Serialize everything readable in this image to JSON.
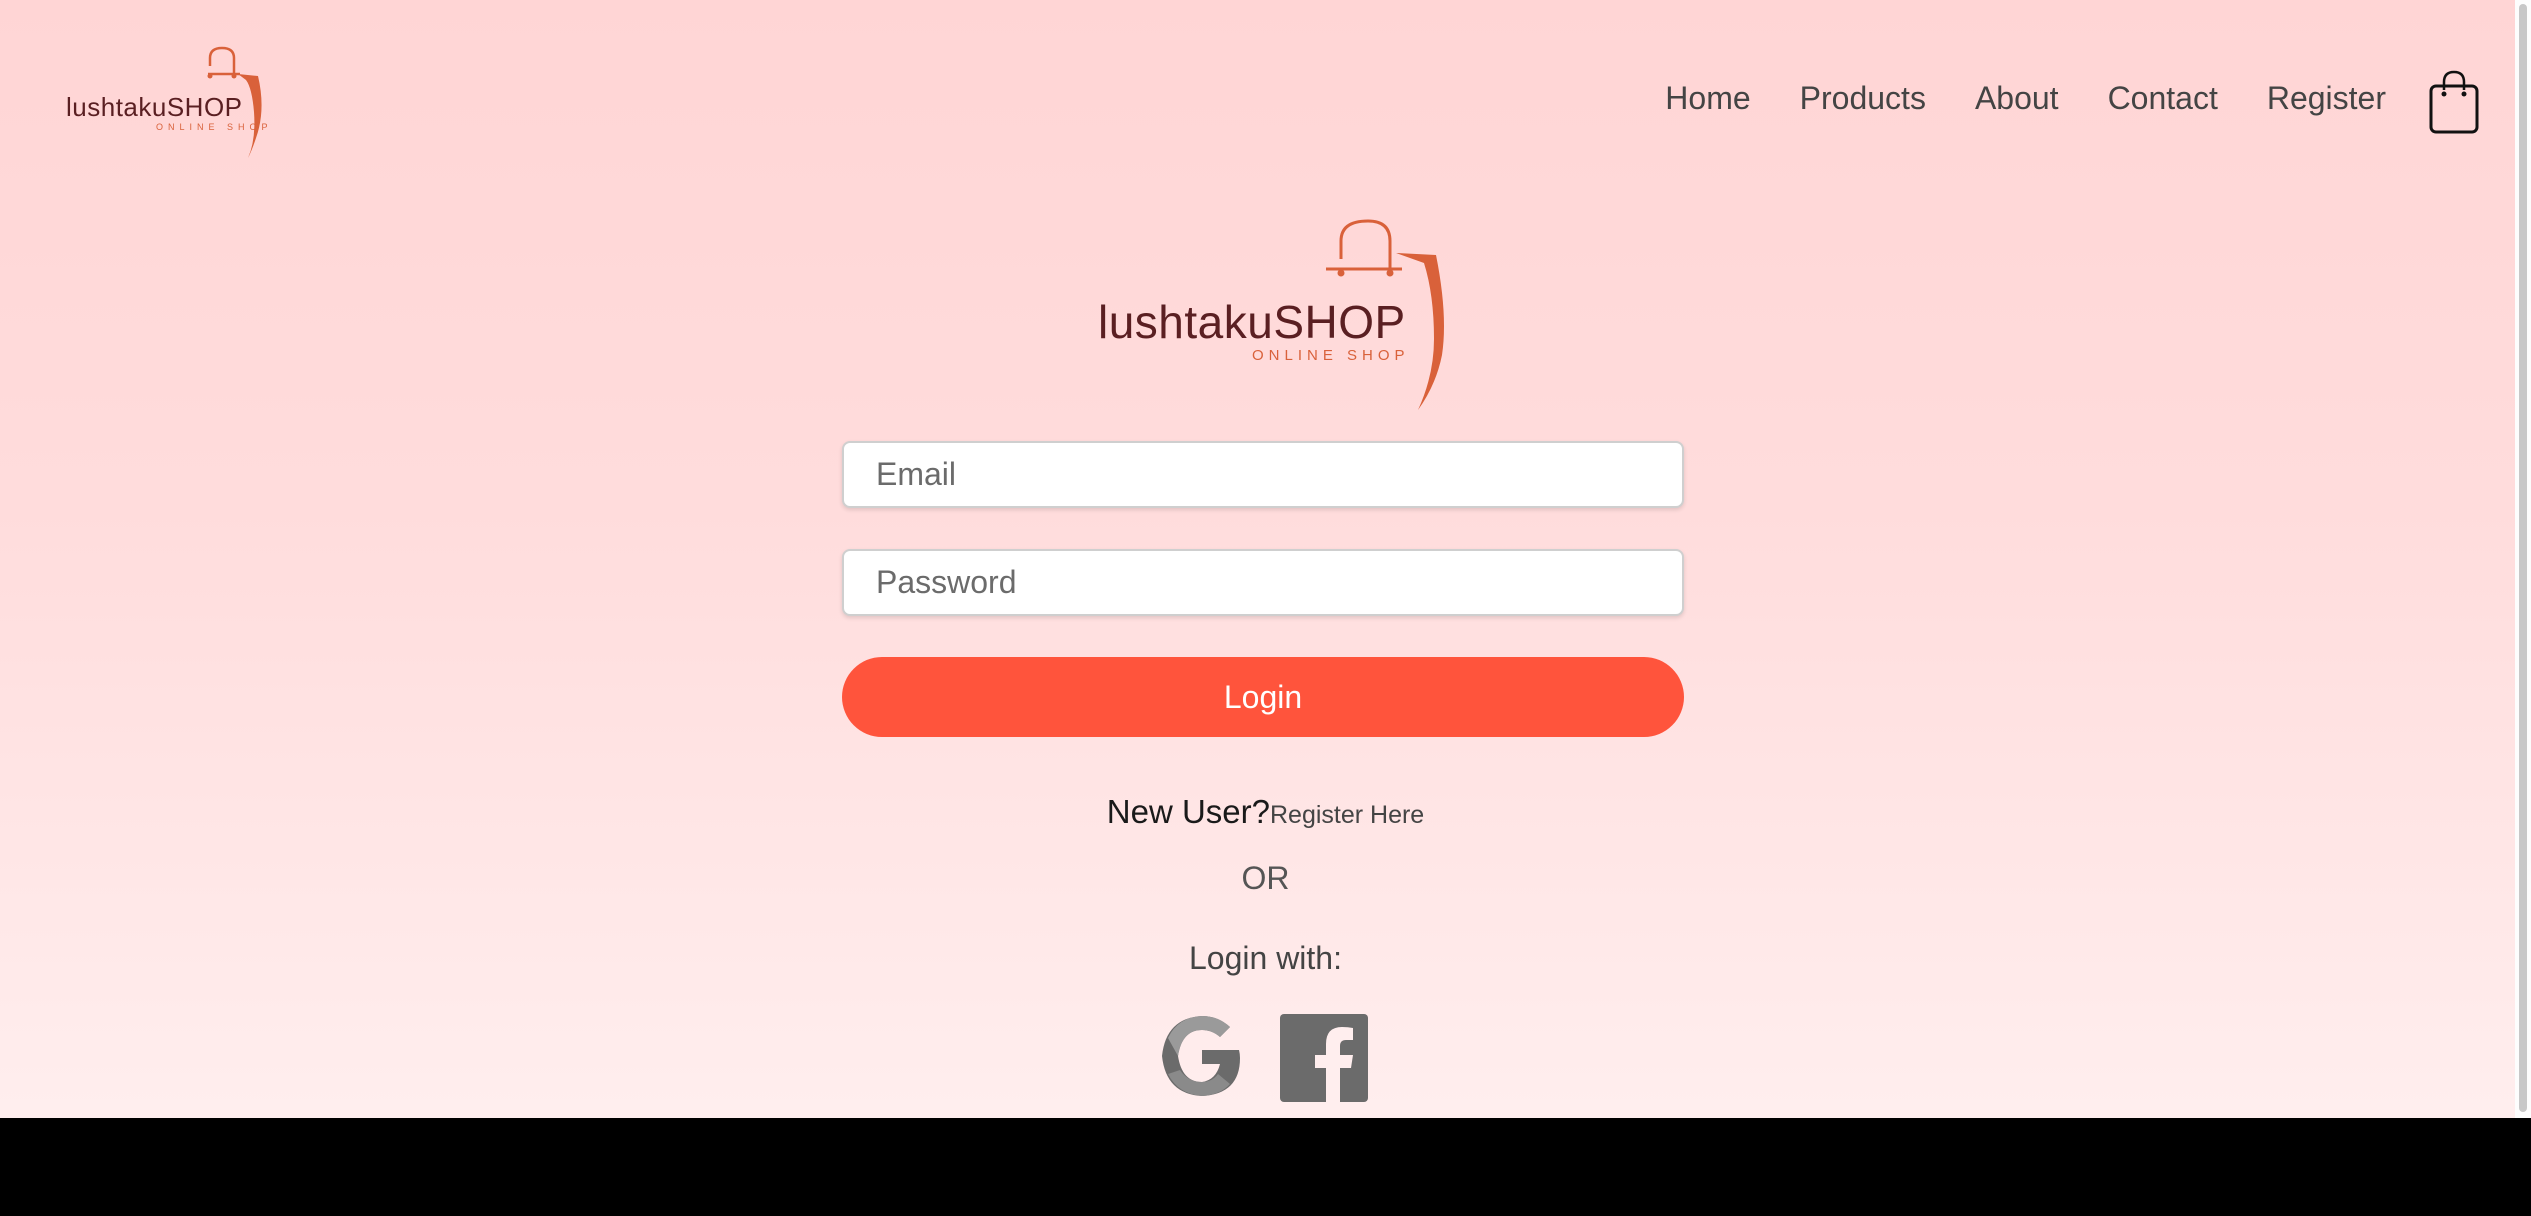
{
  "brand": {
    "name": "lushtakuSHOP",
    "tagline": "ONLINE SHOP",
    "accent_color": "#d9613a",
    "text_color": "#5a1f22"
  },
  "nav": {
    "items": [
      {
        "label": "Home"
      },
      {
        "label": "Products"
      },
      {
        "label": "About"
      },
      {
        "label": "Contact"
      },
      {
        "label": "Register"
      }
    ],
    "cart_icon": "shopping-bag-icon"
  },
  "login_form": {
    "email_placeholder": "Email",
    "password_placeholder": "Password",
    "login_label": "Login",
    "button_color": "#ff543c"
  },
  "signup_prompt": {
    "question": "New User?",
    "link": "Register Here"
  },
  "divider_text": "OR",
  "social_login": {
    "heading": "Login with:",
    "providers": [
      {
        "name": "google",
        "icon": "google-icon"
      },
      {
        "name": "facebook",
        "icon": "facebook-icon"
      }
    ]
  }
}
